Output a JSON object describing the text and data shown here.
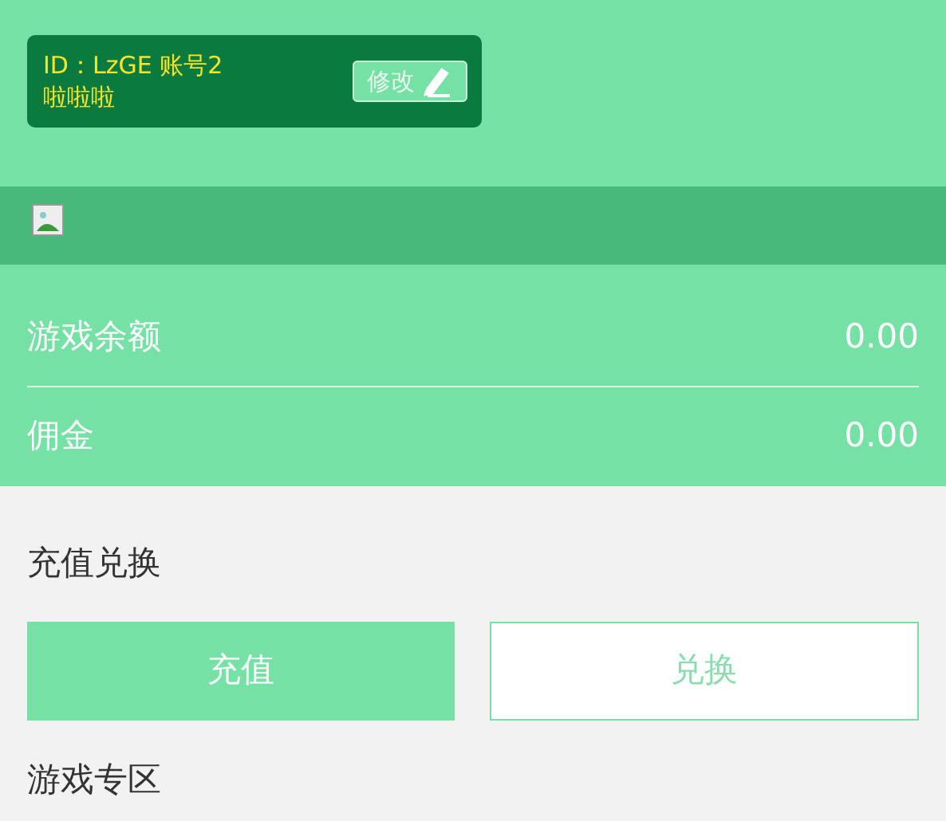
{
  "profile": {
    "id_line": "ID：LzGE 账号2",
    "name": "啦啦啦",
    "edit_button": "修改"
  },
  "balances": [
    {
      "label": "游戏余额",
      "value": "0.00"
    },
    {
      "label": "佣金",
      "value": "0.00"
    }
  ],
  "recharge": {
    "title": "充值兑换",
    "buttons": [
      {
        "label": "充值",
        "selected": true
      },
      {
        "label": "兑换",
        "selected": false
      }
    ]
  },
  "games": {
    "title": "游戏专区"
  }
}
